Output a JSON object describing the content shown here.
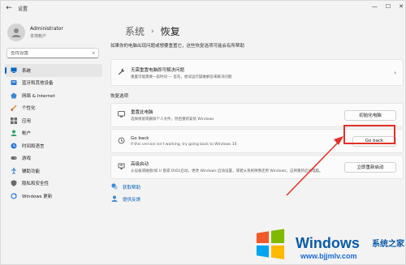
{
  "window": {
    "title": "设置",
    "min_icon": "minimize-icon",
    "max_icon": "maximize-icon",
    "close_icon": "close-icon"
  },
  "account": {
    "name": "Administrator",
    "type": "本地帐户"
  },
  "search": {
    "placeholder": "查找设置"
  },
  "sidebar": {
    "items": [
      {
        "label": "系统",
        "icon": "system-icon",
        "active": true
      },
      {
        "label": "蓝牙和其他设备",
        "icon": "bluetooth-icon"
      },
      {
        "label": "网络 & Internet",
        "icon": "network-icon"
      },
      {
        "label": "个性化",
        "icon": "personalization-icon"
      },
      {
        "label": "应用",
        "icon": "apps-icon"
      },
      {
        "label": "帐户",
        "icon": "accounts-icon"
      },
      {
        "label": "时间和语言",
        "icon": "time-language-icon"
      },
      {
        "label": "游戏",
        "icon": "gaming-icon"
      },
      {
        "label": "辅助功能",
        "icon": "accessibility-icon"
      },
      {
        "label": "隐私和安全性",
        "icon": "privacy-icon"
      },
      {
        "label": "Windows 更新",
        "icon": "windows-update-icon"
      }
    ]
  },
  "header": {
    "crumb1": "系统",
    "separator": "›",
    "crumb2": "恢复",
    "subtitle": "如果你的电脑出现问题或想要重置它，这些恢复选项可能会有所帮助"
  },
  "troubleshoot": {
    "title": "无需重置电脑即可解决问题",
    "desc": "重置可能需要一段时间 — 首先，尝试运行疑难解答来解决问题"
  },
  "recovery_section": {
    "label": "恢复选项"
  },
  "reset": {
    "title": "重置此电脑",
    "desc": "选择保留或删除个人文件，然后重新安装 Windows",
    "button": "初始化电脑"
  },
  "goback": {
    "title": "Go back",
    "desc": "If this version isn't working, try going back to Windows 10",
    "button": "Go back"
  },
  "advanced": {
    "title": "高级启动",
    "desc": "从设备或磁盘(如 U 盘或 DVD)启动，更改 Windows 启动设置，或者从系统映像还原 Windows。这将重新启动电脑。",
    "button": "立即重新启动"
  },
  "links": [
    {
      "label": "获取帮助",
      "icon": "help-icon"
    },
    {
      "label": "提供反馈",
      "icon": "feedback-icon"
    }
  ],
  "annotation": {
    "color": "#e33027"
  },
  "watermark": {
    "brand": "Windows",
    "cn": "系统之家",
    "url": "www.bjjmlv.com"
  },
  "colors": {
    "accent": "#005fb8",
    "highlight": "#e33027"
  }
}
